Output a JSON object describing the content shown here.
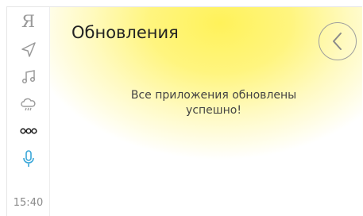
{
  "sidebar": {
    "items": [
      {
        "icon": "yandex-icon",
        "glyph": "Я"
      },
      {
        "icon": "navigation-arrow-icon"
      },
      {
        "icon": "music-icon"
      },
      {
        "icon": "weather-cloud-icon"
      },
      {
        "icon": "more-dots-icon"
      },
      {
        "icon": "microphone-icon"
      }
    ],
    "time": "15:40"
  },
  "header": {
    "title": "Обновления",
    "back_icon": "chevron-left-icon"
  },
  "main": {
    "message_line1": "Все приложения обновлены",
    "message_line2": "успешно!"
  },
  "colors": {
    "accent": "#3aa7d9",
    "glow": "#fff25a",
    "icon": "#9a9a9a"
  }
}
